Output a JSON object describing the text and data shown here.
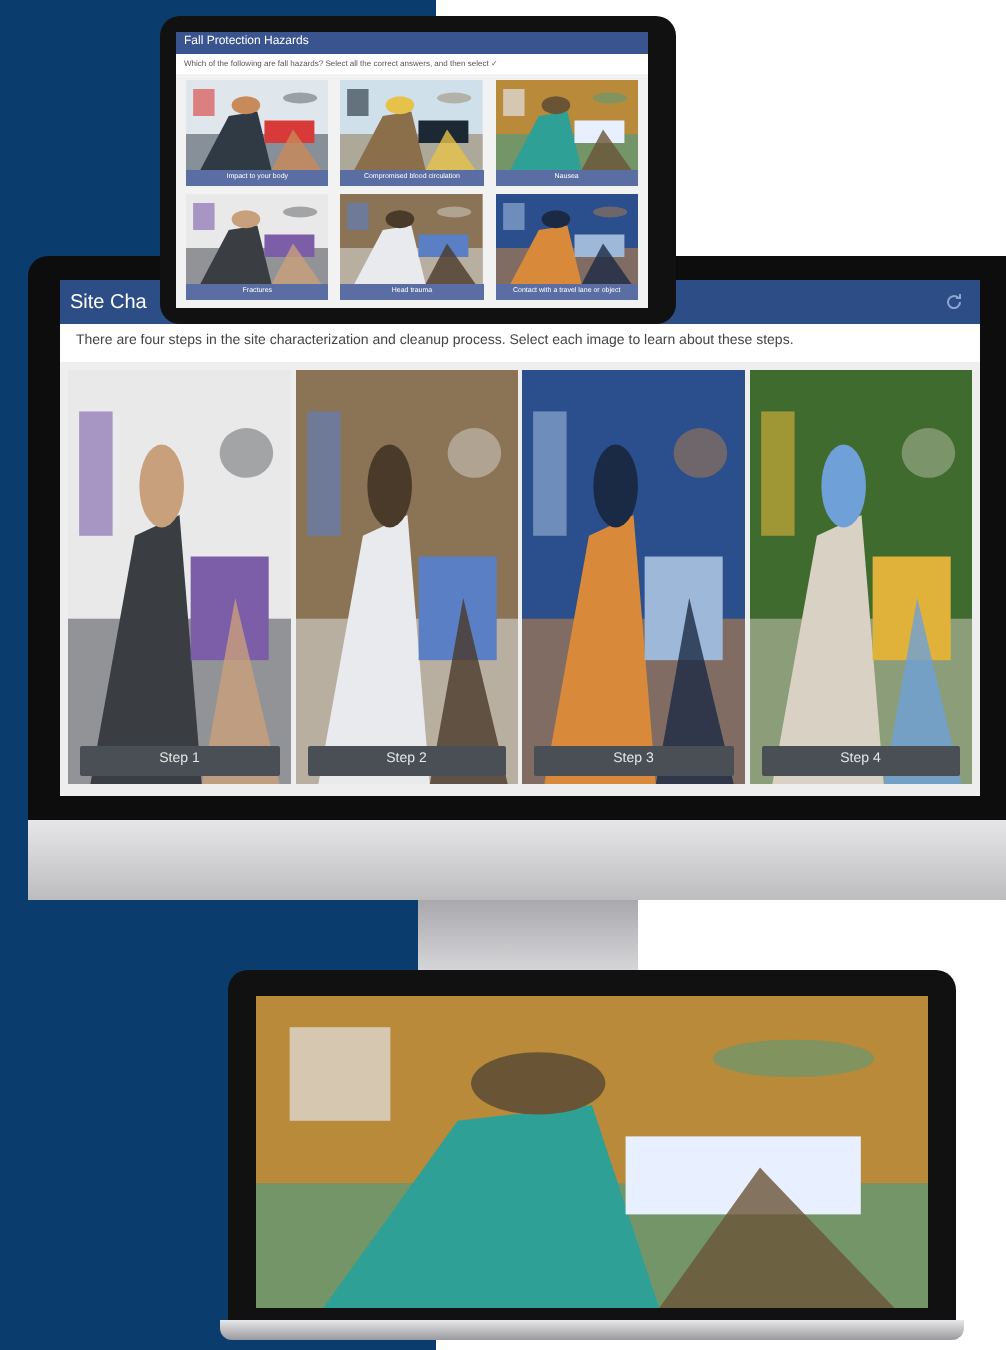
{
  "tablet": {
    "title": "Fall Protection Hazards",
    "prompt": "Which of the following are fall hazards? Select all the correct answers, and then select ✓",
    "cards": [
      {
        "label": "Impact to your body"
      },
      {
        "label": "Compromised blood circulation"
      },
      {
        "label": "Nausea"
      },
      {
        "label": "Fractures"
      },
      {
        "label": "Head trauma"
      },
      {
        "label": "Contact with a travel lane or object"
      }
    ]
  },
  "monitor": {
    "title": "Site Cha",
    "instructions": "There are four steps in the site characterization and cleanup process. Select each image to learn about these steps.",
    "steps": [
      {
        "label": "Step 1"
      },
      {
        "label": "Step 2"
      },
      {
        "label": "Step 3"
      },
      {
        "label": "Step 4"
      }
    ]
  }
}
